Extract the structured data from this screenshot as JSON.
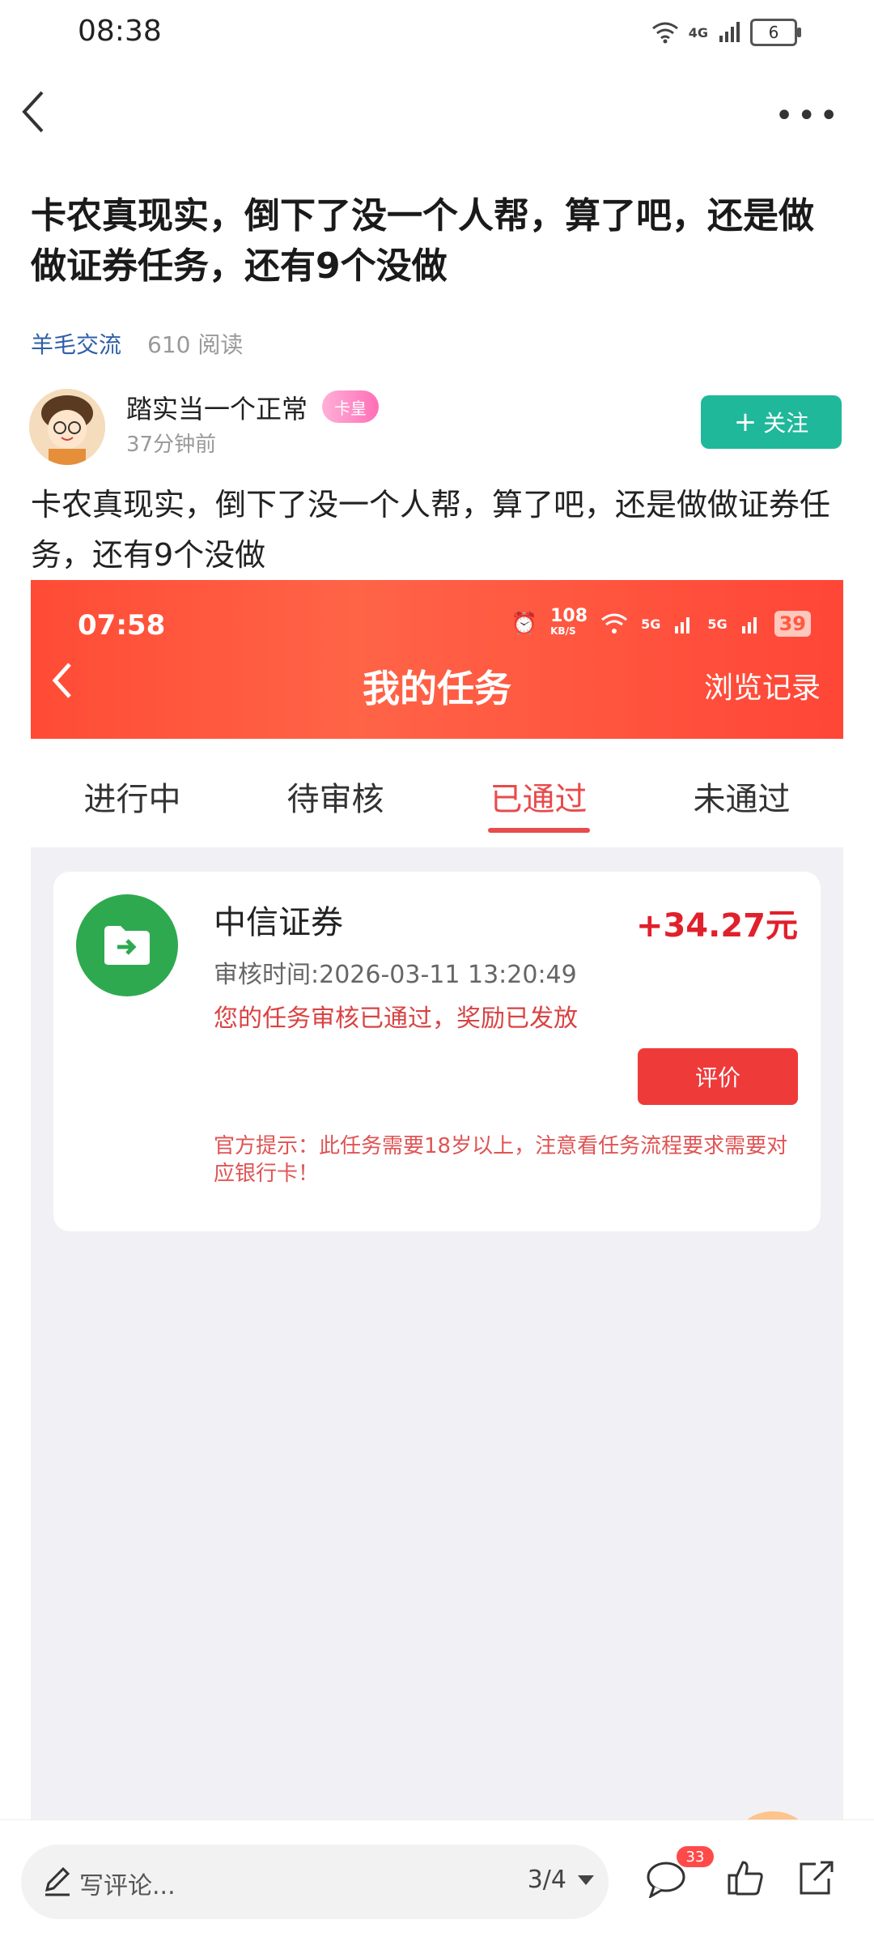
{
  "status_bar": {
    "time": "08:38",
    "network": "4G",
    "battery": "6"
  },
  "post": {
    "title": "卡农真现实，倒下了没一个人帮，算了吧，还是做做证券任务，还有9个没做",
    "category": "羊毛交流",
    "read_count": "610 阅读",
    "author": {
      "name": "踏实当一个正常",
      "badge": "卡皇",
      "time": "37分钟前"
    },
    "follow_label": "关注",
    "body": "卡农真现实，倒下了没一个人帮，算了吧，还是做做证券任务，还有9个没做"
  },
  "embedded": {
    "status_time": "07:58",
    "status_speed": "108",
    "status_speed_unit": "KB/S",
    "status_5g": "5G",
    "status_battery": "39",
    "title": "我的任务",
    "history": "浏览记录",
    "tabs": [
      {
        "label": "进行中",
        "active": false
      },
      {
        "label": "待审核",
        "active": false
      },
      {
        "label": "已通过",
        "active": true
      },
      {
        "label": "未通过",
        "active": false
      }
    ],
    "card": {
      "company": "中信证券",
      "amount": "+34.27元",
      "review_time": "审核时间:2026-03-11 13:20:49",
      "status_msg": "您的任务审核已通过，奖励已发放",
      "rate_button": "评价",
      "tip": "官方提示：此任务需要18岁以上，注意看任务流程要求需要对应银行卡！"
    }
  },
  "bottom_bar": {
    "comment_placeholder": "写评论...",
    "page": "3/4",
    "comment_count": "33"
  },
  "colors": {
    "accent_green": "#1fb89a",
    "accent_red": "#ff4b35",
    "link_blue": "#2f5fa8"
  }
}
